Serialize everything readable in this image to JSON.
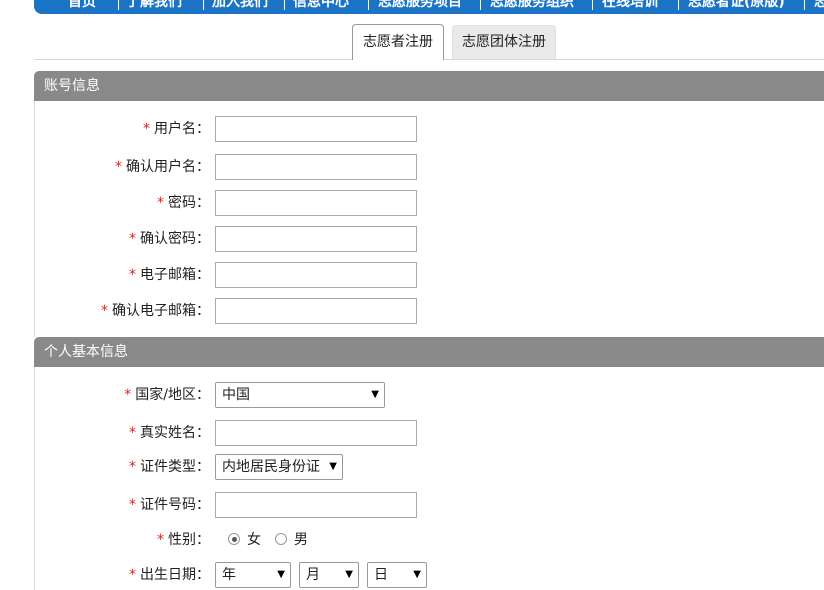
{
  "topnav": {
    "items": [
      "首页",
      "了解我们",
      "加入我们",
      "信息中心",
      "志愿服务项目",
      "志愿服务组织",
      "在线培训",
      "志愿者证(原版)",
      "志"
    ]
  },
  "tabs": [
    {
      "label": "志愿者注册",
      "active": true
    },
    {
      "label": "志愿团体注册",
      "active": false
    }
  ],
  "account_section": {
    "title": "账号信息",
    "fields": [
      {
        "label": "用户名：",
        "value": ""
      },
      {
        "label": "确认用户名：",
        "value": ""
      },
      {
        "label": "密码：",
        "value": ""
      },
      {
        "label": "确认密码：",
        "value": ""
      },
      {
        "label": "电子邮箱：",
        "value": ""
      },
      {
        "label": "确认电子邮箱：",
        "value": ""
      }
    ]
  },
  "personal_section": {
    "title": "个人基本信息",
    "country": {
      "label": "国家/地区：",
      "value": "中国"
    },
    "real_name": {
      "label": "真实姓名：",
      "value": ""
    },
    "id_type": {
      "label": "证件类型：",
      "value": "内地居民身份证"
    },
    "id_number": {
      "label": "证件号码：",
      "value": ""
    },
    "gender": {
      "label": "性别：",
      "options": [
        "女",
        "男"
      ],
      "selected": "女"
    },
    "birth_date": {
      "label": "出生日期：",
      "year": "年",
      "month": "月",
      "day": "日"
    }
  },
  "required_marker": "*",
  "colors": {
    "nav": "#1a73c5",
    "section_header": "#898989",
    "required": "#e02020"
  }
}
